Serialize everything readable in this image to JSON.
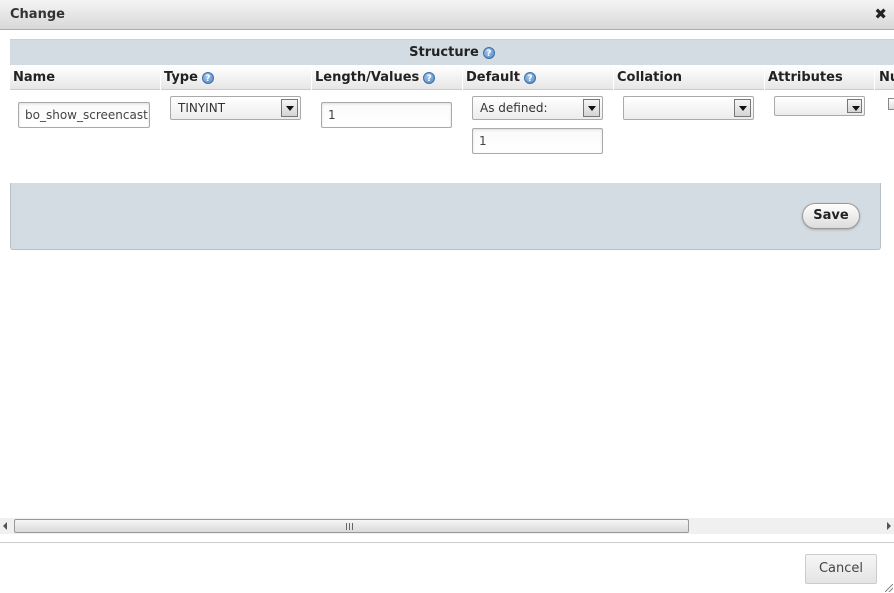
{
  "dialog": {
    "title": "Change",
    "close_symbol": "✖"
  },
  "structure": {
    "header": "Structure",
    "help_symbol": "?"
  },
  "columns": {
    "name": "Name",
    "type": "Type",
    "length_values": "Length/Values",
    "default": "Default",
    "collation": "Collation",
    "attributes": "Attributes",
    "null_partial": "Nu"
  },
  "field": {
    "name_value": "bo_show_screencast",
    "type_value": "TINYINT",
    "length_value": "1",
    "default_option": "As defined:",
    "default_value": "1",
    "collation_value": "",
    "attributes_value": "",
    "null_checked": false
  },
  "buttons": {
    "save": "Save",
    "cancel": "Cancel"
  },
  "scrollbar": {
    "thumb_fraction": 0.77,
    "position_fraction": 0.0
  },
  "icons": {
    "help": "help-icon",
    "close": "close-icon",
    "dropdown": "chevron-down-icon"
  }
}
